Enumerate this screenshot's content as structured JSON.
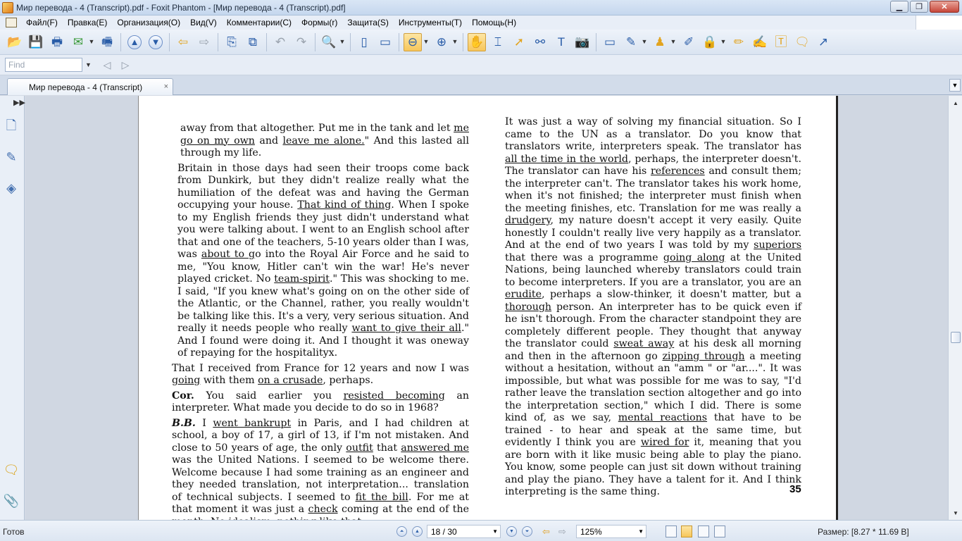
{
  "window": {
    "title": "Мир перевода - 4 (Transcript).pdf - Foxit Phantom - [Мир перевода - 4 (Transcript).pdf]",
    "minimize": "▁",
    "restore": "❐",
    "close": "✕"
  },
  "menu": [
    "Файл(F)",
    "Правка(E)",
    "Организация(O)",
    "Вид(V)",
    "Комментарии(C)",
    "Формы(r)",
    "Защита(S)",
    "Инструменты(T)",
    "Помощь(H)"
  ],
  "findbar": {
    "placeholder": "Find"
  },
  "tab": {
    "label": "Мир перевода - 4 (Transcript)",
    "close": "×"
  },
  "document": {
    "page_number": "35"
  },
  "status": {
    "ready": "Готов",
    "page": "18 / 30",
    "zoom": "125%",
    "size": "Размер: [8.27 * 11.69 В]"
  },
  "icons": {
    "expand_panel": "double-arrow-right-icon",
    "pages_panel": "page-thumbnails-icon",
    "bookmarks_panel": "bookmark-pen-icon",
    "layers_panel": "layers-icon",
    "comments_panel": "comment-icon",
    "attachments_panel": "paperclip-icon"
  }
}
